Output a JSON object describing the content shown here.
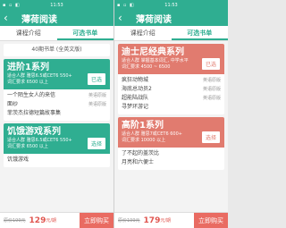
{
  "left": {
    "status": {
      "icons": "▪ ▫ ◧",
      "time": "11:53"
    },
    "title": "薄荷阅读",
    "tabs": [
      "课程介绍",
      "可选书单"
    ],
    "issue": "40期书单 (全英文版)",
    "card1": {
      "title": "进阶1系列",
      "meta1": "适合人群 雅思6.5或CET6 550+",
      "meta2": "词汇要求 6500 以上",
      "button": "已选",
      "books": [
        {
          "name": "一个陌生女人的来信",
          "tag": "英语原版"
        },
        {
          "name": "面纱",
          "tag": "英语原版"
        },
        {
          "name": "菲茨杰拉德短篇故事集",
          "tag": ""
        }
      ]
    },
    "card2": {
      "title": "饥饿游戏系列",
      "meta1": "适合人群 雅思6.5或CET6 550+",
      "meta2": "词汇要求 6500 以上",
      "button": "选择",
      "books": [
        {
          "name": "饥饿游戏",
          "tag": ""
        }
      ]
    },
    "bottom": {
      "old": "原价199元",
      "price": "129",
      "unit": "元/期",
      "buy": "立即购买"
    }
  },
  "right": {
    "status": {
      "icons": "▪ ▫ ◧",
      "time": "11:53"
    },
    "title": "薄荷阅读",
    "tabs": [
      "课程介绍",
      "可选书单"
    ],
    "card1": {
      "title": "迪士尼经典系列",
      "meta1": "适合人群 掌握基本词汇, 中学水平",
      "meta2": "词汇要求 4500 ~ 6500",
      "button": "已选",
      "books": [
        {
          "name": "疯狂动物城",
          "tag": "英语原版"
        },
        {
          "name": "海底总动员2",
          "tag": "英语原版"
        },
        {
          "name": "超能陆战队",
          "tag": "英语原版"
        },
        {
          "name": "寻梦环游记",
          "tag": ""
        }
      ]
    },
    "card2": {
      "title": "高阶1系列",
      "meta1": "适合人群 雅思7或CET6 600+",
      "meta2": "词汇要求 10000 以上",
      "button": "选择",
      "books": [
        {
          "name": "了不起的盖茨比",
          "tag": ""
        },
        {
          "name": "月亮和六便士",
          "tag": ""
        }
      ]
    },
    "bottom": {
      "old": "原价199元",
      "price": "179",
      "unit": "元/期",
      "buy": "立即购买"
    }
  }
}
